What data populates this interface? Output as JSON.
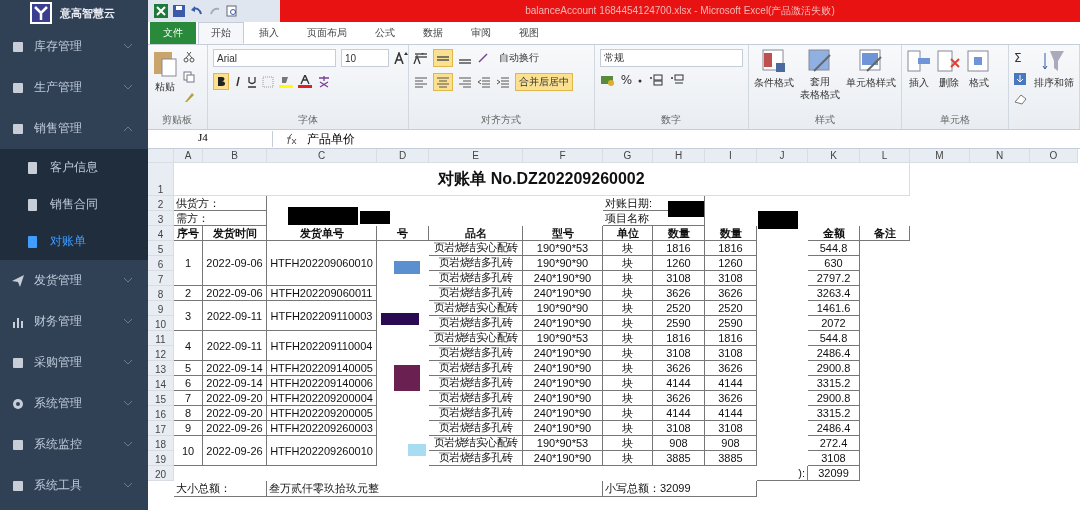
{
  "sidebar": {
    "logo_text": "意高智慧云",
    "items": [
      {
        "label": "库存管理",
        "expanded": false
      },
      {
        "label": "生产管理",
        "expanded": false
      },
      {
        "label": "销售管理",
        "expanded": true,
        "children": [
          {
            "label": "客户信息",
            "selected": false
          },
          {
            "label": "销售合同",
            "selected": false
          },
          {
            "label": "对账单",
            "selected": true
          }
        ]
      },
      {
        "label": "发货管理",
        "expanded": false
      },
      {
        "label": "财务管理",
        "expanded": false
      },
      {
        "label": "采购管理",
        "expanded": false
      },
      {
        "label": "系统管理",
        "expanded": false
      },
      {
        "label": "系统监控",
        "expanded": false
      },
      {
        "label": "系统工具",
        "expanded": false
      }
    ]
  },
  "excel": {
    "title": "balanceAccount 1684454124700.xlsx - Microsoft Excel(产品激活失败)",
    "tabs": [
      {
        "label": "文件",
        "kind": "file",
        "selected": false
      },
      {
        "label": "开始",
        "kind": "tab",
        "selected": true
      },
      {
        "label": "插入",
        "kind": "tab",
        "selected": false
      },
      {
        "label": "页面布局",
        "kind": "tab",
        "selected": false
      },
      {
        "label": "公式",
        "kind": "tab",
        "selected": false
      },
      {
        "label": "数据",
        "kind": "tab",
        "selected": false
      },
      {
        "label": "审阅",
        "kind": "tab",
        "selected": false
      },
      {
        "label": "视图",
        "kind": "tab",
        "selected": false
      }
    ],
    "ribbon": {
      "paste": "粘贴",
      "clipboard_label": "剪贴板",
      "font_name": "Arial",
      "font_size": "10",
      "font_label": "字体",
      "wrap_text": "自动换行",
      "merge_center": "合并后居中",
      "alignment_label": "对齐方式",
      "number_format": "常规",
      "percent": "%",
      "number_label": "数字",
      "conditional_format": "条件格式",
      "table_format": [
        "套用",
        "表格格式"
      ],
      "cell_styles": "单元格样式",
      "styles_label": "样式",
      "insert": "插入",
      "delete": "删除",
      "format": "格式",
      "cells_label": "单元格",
      "sum": "Σ",
      "sort_filter": "排序和筛"
    },
    "formula_bar": {
      "cell_ref": "J4",
      "content": "产品单价"
    },
    "columns": [
      "A",
      "B",
      "C",
      "D",
      "E",
      "F",
      "G",
      "H",
      "I",
      "J",
      "K",
      "L",
      "M",
      "N",
      "O"
    ],
    "sheet": {
      "title": "对账单 No.DZ202209260002",
      "supplier_label": "供货方：",
      "buyer_label": "需方：",
      "date_label": "对账日期:",
      "project_label": "项目名称",
      "row_numbers": [
        "1",
        "2",
        "3",
        "4",
        "5",
        "6",
        "7",
        "8",
        "9",
        "10",
        "11",
        "12",
        "13",
        "14",
        "15",
        "16",
        "17",
        "18",
        "19",
        "20"
      ],
      "headers": [
        "序号",
        "发货时间",
        "发货单号",
        "号",
        "品名",
        "型号",
        "单位",
        "数量",
        "数量",
        "金额",
        "备注"
      ],
      "deliveries": [
        {
          "seq": "1",
          "date": "2022-09-06",
          "order": "HTFH202209060010",
          "items": [
            {
              "name": "页岩烧结实心配砖",
              "model": "190*90*53",
              "unit": "块",
              "qty": "1816",
              "qty2": "1816",
              "amount": "544.8"
            },
            {
              "name": "页岩烧结多孔砖",
              "model": "190*90*90",
              "unit": "块",
              "qty": "1260",
              "qty2": "1260",
              "amount": "630"
            },
            {
              "name": "页岩烧结多孔砖",
              "model": "240*190*90",
              "unit": "块",
              "qty": "3108",
              "qty2": "3108",
              "amount": "2797.2"
            }
          ]
        },
        {
          "seq": "2",
          "date": "2022-09-06",
          "order": "HTFH202209060011",
          "items": [
            {
              "name": "页岩烧结多孔砖",
              "model": "240*190*90",
              "unit": "块",
              "qty": "3626",
              "qty2": "3626",
              "amount": "3263.4"
            }
          ]
        },
        {
          "seq": "3",
          "date": "2022-09-11",
          "order": "HTFH202209110003",
          "items": [
            {
              "name": "页岩烧结实心配砖",
              "model": "190*90*90",
              "unit": "块",
              "qty": "2520",
              "qty2": "2520",
              "amount": "1461.6"
            },
            {
              "name": "页岩烧结多孔砖",
              "model": "240*190*90",
              "unit": "块",
              "qty": "2590",
              "qty2": "2590",
              "amount": "2072"
            }
          ]
        },
        {
          "seq": "4",
          "date": "2022-09-11",
          "order": "HTFH202209110004",
          "items": [
            {
              "name": "页岩烧结实心配砖",
              "model": "190*90*53",
              "unit": "块",
              "qty": "1816",
              "qty2": "1816",
              "amount": "544.8"
            },
            {
              "name": "页岩烧结多孔砖",
              "model": "240*190*90",
              "unit": "块",
              "qty": "3108",
              "qty2": "3108",
              "amount": "2486.4"
            }
          ]
        },
        {
          "seq": "5",
          "date": "2022-09-14",
          "order": "HTFH202209140005",
          "items": [
            {
              "name": "页岩烧结多孔砖",
              "model": "240*190*90",
              "unit": "块",
              "qty": "3626",
              "qty2": "3626",
              "amount": "2900.8"
            }
          ]
        },
        {
          "seq": "6",
          "date": "2022-09-14",
          "order": "HTFH202209140006",
          "items": [
            {
              "name": "页岩烧结多孔砖",
              "model": "240*190*90",
              "unit": "块",
              "qty": "4144",
              "qty2": "4144",
              "amount": "3315.2"
            }
          ]
        },
        {
          "seq": "7",
          "date": "2022-09-20",
          "order": "HTFH202209200004",
          "items": [
            {
              "name": "页岩烧结多孔砖",
              "model": "240*190*90",
              "unit": "块",
              "qty": "3626",
              "qty2": "3626",
              "amount": "2900.8"
            }
          ]
        },
        {
          "seq": "8",
          "date": "2022-09-20",
          "order": "HTFH202209200005",
          "items": [
            {
              "name": "页岩烧结多孔砖",
              "model": "240*190*90",
              "unit": "块",
              "qty": "4144",
              "qty2": "4144",
              "amount": "3315.2"
            }
          ]
        },
        {
          "seq": "9",
          "date": "2022-09-26",
          "order": "HTFH202209260003",
          "items": [
            {
              "name": "页岩烧结多孔砖",
              "model": "240*190*90",
              "unit": "块",
              "qty": "3108",
              "qty2": "3108",
              "amount": "2486.4"
            }
          ]
        },
        {
          "seq": "10",
          "date": "2022-09-26",
          "order": "HTFH202209260010",
          "items": [
            {
              "name": "页岩烧结实心配砖",
              "model": "190*90*53",
              "unit": "块",
              "qty": "908",
              "qty2": "908",
              "amount": "272.4"
            },
            {
              "name": "页岩烧结多孔砖",
              "model": "240*190*90",
              "unit": "块",
              "qty": "3885",
              "qty2": "3885",
              "amount": "3108"
            }
          ]
        }
      ],
      "total_suffix": "):",
      "total": "32099",
      "words_label": "大小总额：",
      "words_total": "叁万贰仟零玖拾玖元整",
      "small_total": "小写总额：32099"
    }
  }
}
